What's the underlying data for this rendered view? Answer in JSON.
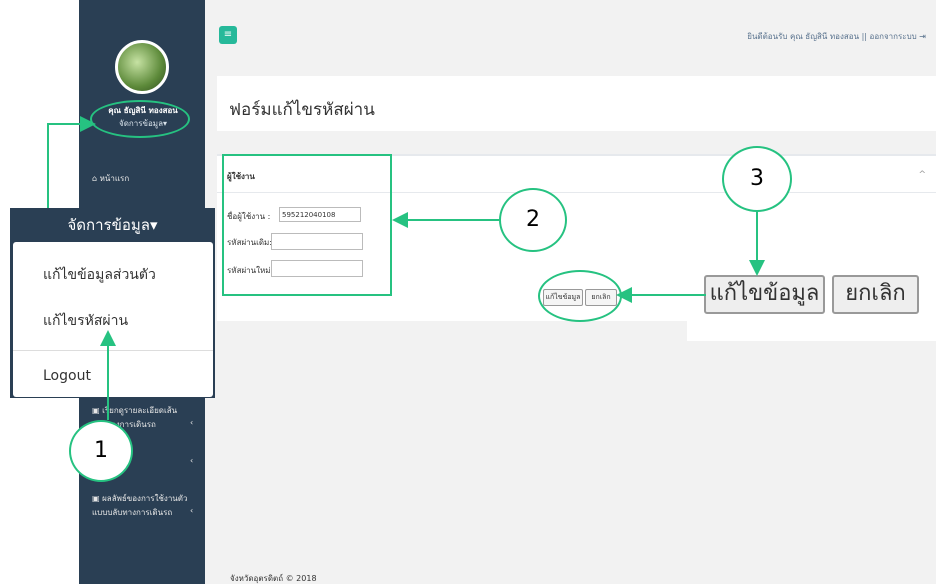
{
  "sidebar": {
    "user_name": "คุณ ธัญสินี ทองสอน",
    "manage_label": "จัดการข้อมูล",
    "items": [
      {
        "label": "หน้าแรก"
      },
      {
        "label": "เรียกดูรายละเอียดเส้น"
      },
      {
        "label": "ทางการเดินรถ"
      },
      {
        "label": "ผลลัพธ์ของการใช้งานตัว"
      },
      {
        "label": "แบบบลับทางการเดินรถ"
      }
    ]
  },
  "topbar": {
    "menu_icon": "≡",
    "welcome": "ยินดีต้อนรับ คุณ ธัญสินี ทองสอน || ออกจากระบบ"
  },
  "page": {
    "title": "ฟอร์มแก้ไขรหัสผ่าน"
  },
  "form": {
    "section_title": "ผู้ใช้งาน",
    "username_label": "ชื่อผู้ใช้งาน :",
    "username_value": "595212040108",
    "old_password_label": "รหัสผ่านเดิม:",
    "new_password_label": "รหัสผ่านใหม่:",
    "save_label": "แก้ไขข้อมูล",
    "cancel_label": "ยกเลิก"
  },
  "zoom": {
    "save_label": "แก้ไขข้อมูล",
    "cancel_label": "ยกเลิก"
  },
  "menu_overlay": {
    "header": "จัดการข้อมูล",
    "items": [
      {
        "label": "แก้ไขข้อมูลส่วนตัว"
      },
      {
        "label": "แก้ไขรหัสผ่าน"
      },
      {
        "label": "Logout"
      }
    ]
  },
  "callouts": [
    "1",
    "2",
    "3"
  ],
  "footer": "จังหวัดอุตรดิตถ์ © 2018",
  "colors": {
    "sidebar": "#2a3f54",
    "accent": "#26b99a",
    "annotation": "#26c281"
  }
}
